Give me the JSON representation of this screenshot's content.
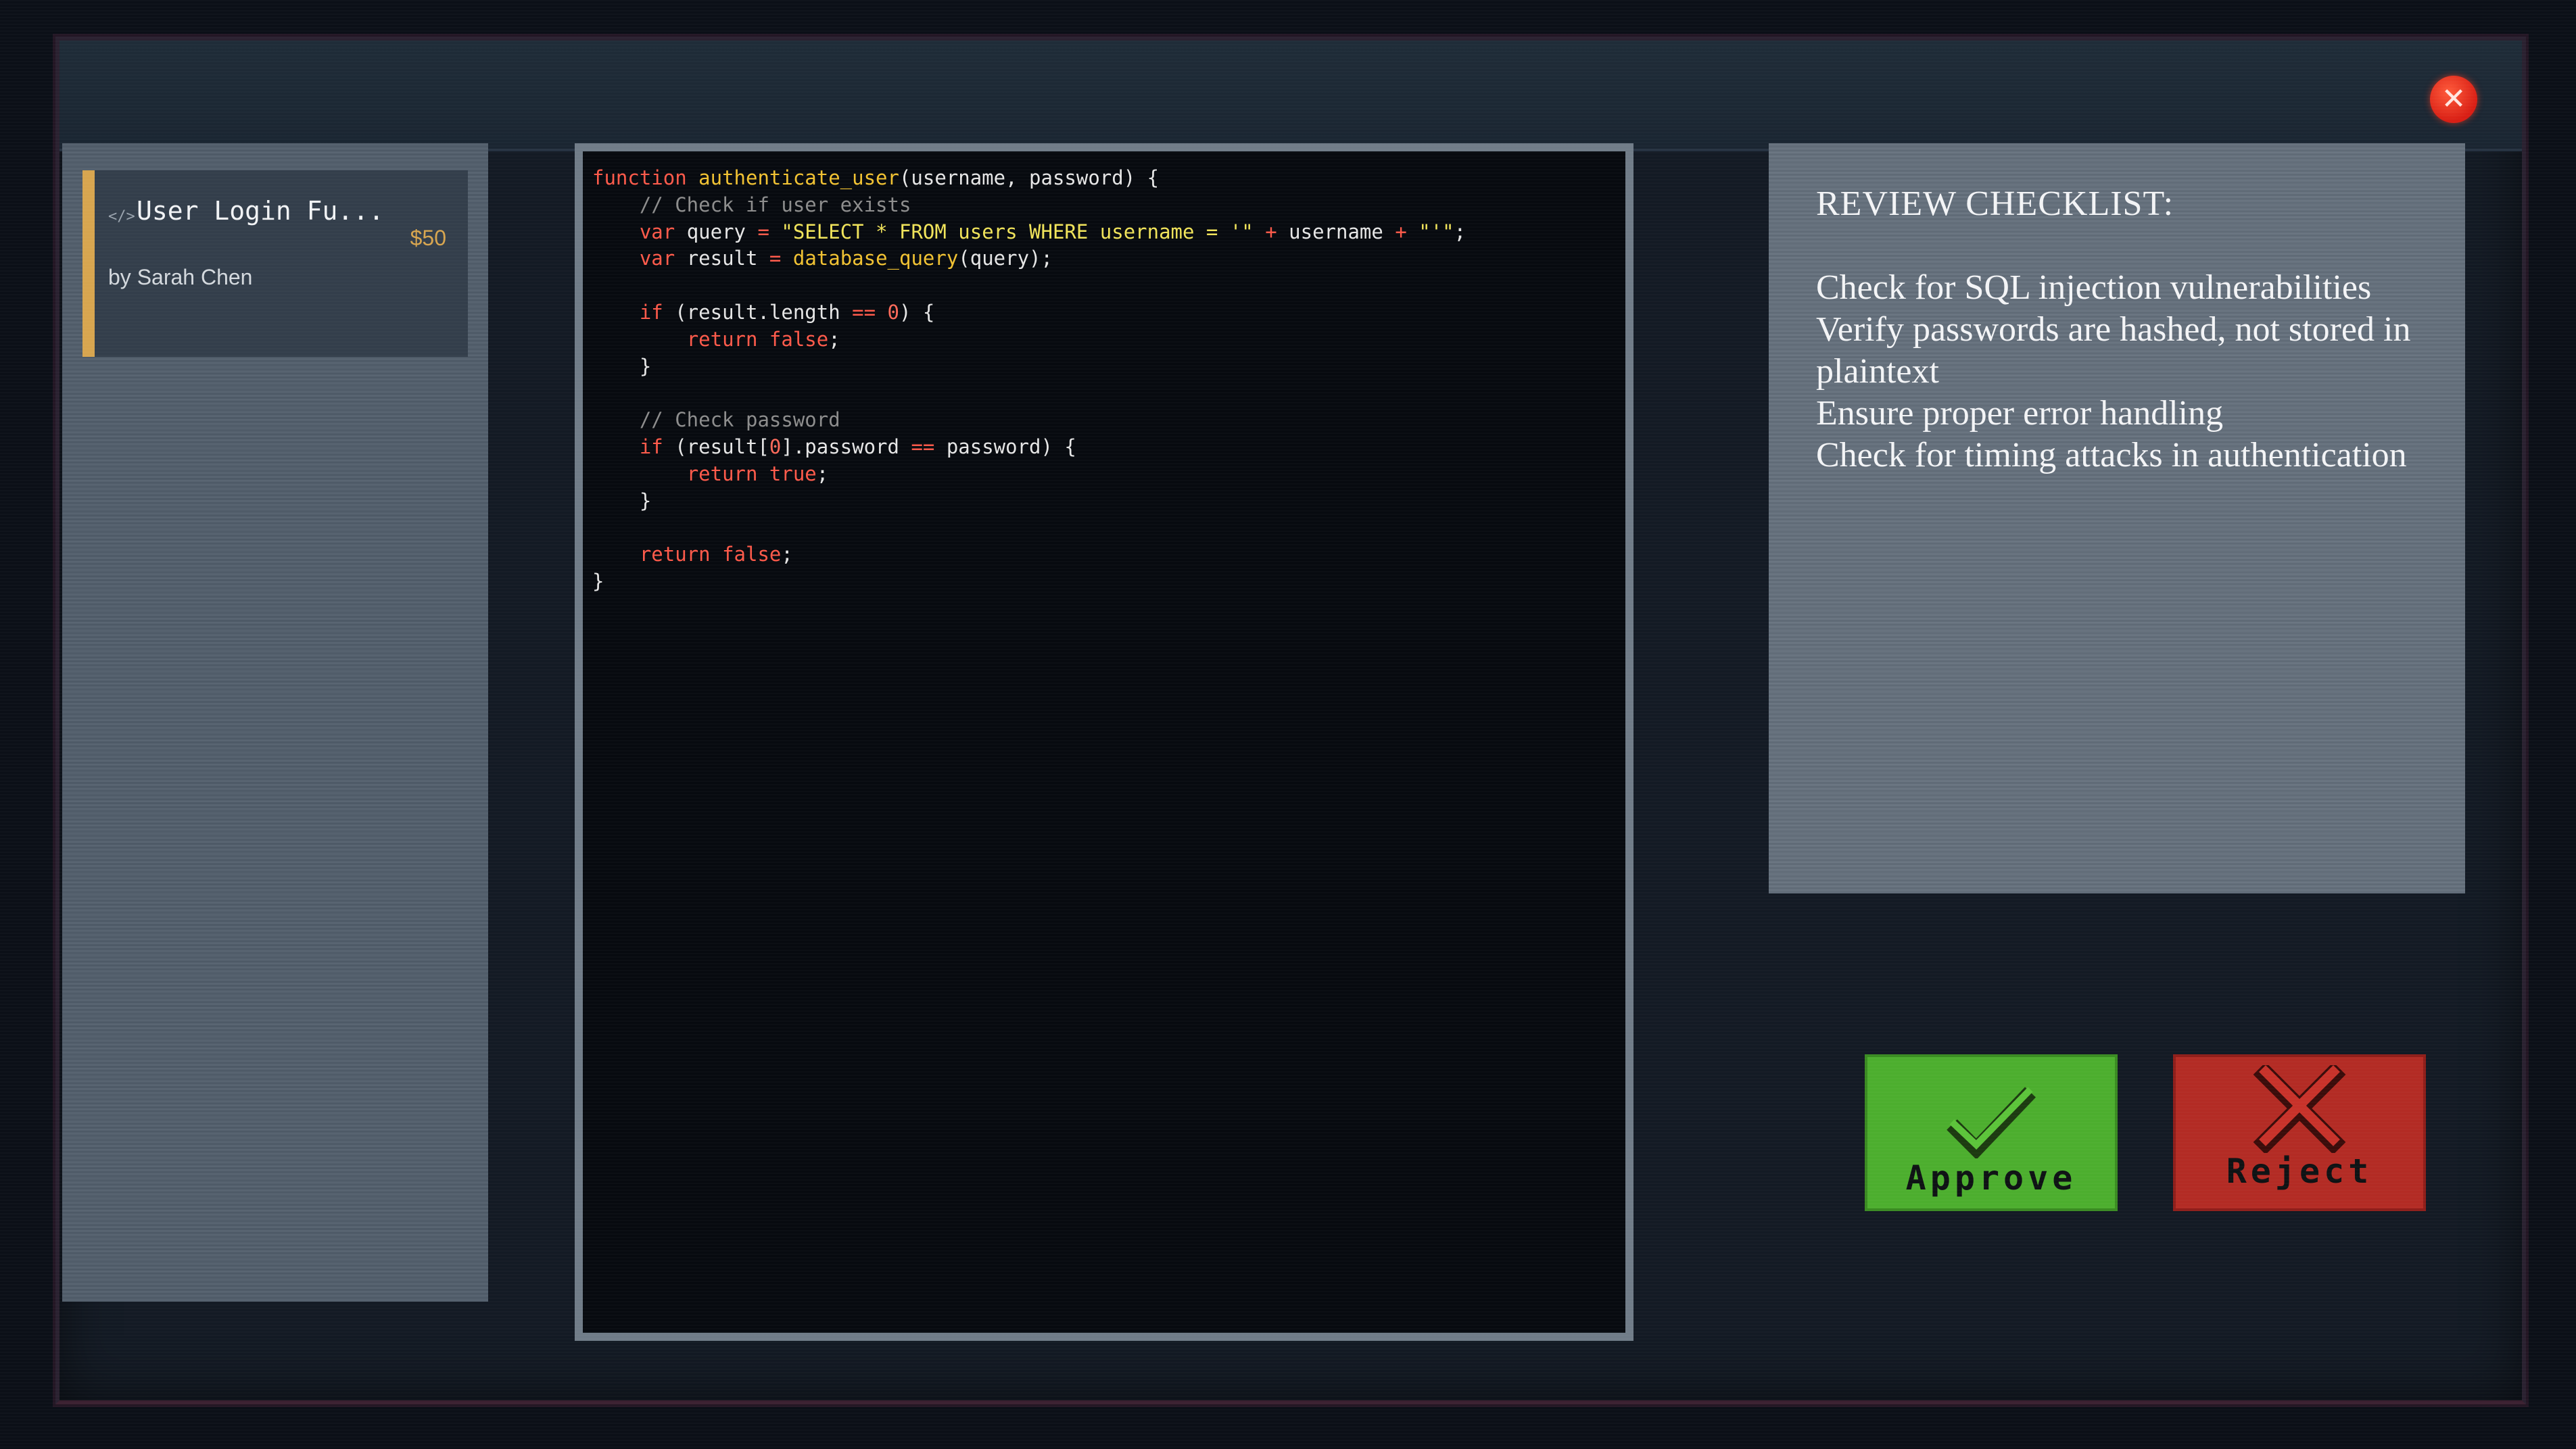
{
  "window": {
    "close_icon": "close-icon",
    "close_glyph": "✕"
  },
  "task_list": {
    "items": [
      {
        "icon": "code-icon",
        "icon_glyph": "</>",
        "title": "User Login Fu...",
        "reward": "$50",
        "author": "by Sarah Chen",
        "accent_color": "#d7a54f"
      }
    ]
  },
  "code_viewer": {
    "language_colors": {
      "keyword": "#ff5a4a",
      "function": "#f1c232",
      "string": "#f0e35a",
      "comment": "#8d8d8d"
    },
    "lines": [
      [
        {
          "t": "kw",
          "v": "function"
        },
        {
          "t": "",
          "v": " "
        },
        {
          "t": "fn",
          "v": "authenticate_user"
        },
        {
          "t": "",
          "v": "(username, password) {"
        }
      ],
      [
        {
          "t": "",
          "v": "    "
        },
        {
          "t": "cm",
          "v": "// Check if user exists"
        }
      ],
      [
        {
          "t": "",
          "v": "    "
        },
        {
          "t": "kw",
          "v": "var"
        },
        {
          "t": "",
          "v": " query "
        },
        {
          "t": "op",
          "v": "="
        },
        {
          "t": "",
          "v": " "
        },
        {
          "t": "str",
          "v": "\"SELECT * FROM users WHERE username = '\""
        },
        {
          "t": "",
          "v": " "
        },
        {
          "t": "op",
          "v": "+"
        },
        {
          "t": "",
          "v": " username "
        },
        {
          "t": "op",
          "v": "+"
        },
        {
          "t": "",
          "v": " "
        },
        {
          "t": "str",
          "v": "\"'\""
        },
        {
          "t": "",
          "v": ";"
        }
      ],
      [
        {
          "t": "",
          "v": "    "
        },
        {
          "t": "kw",
          "v": "var"
        },
        {
          "t": "",
          "v": " result "
        },
        {
          "t": "op",
          "v": "="
        },
        {
          "t": "",
          "v": " "
        },
        {
          "t": "fn",
          "v": "database_query"
        },
        {
          "t": "",
          "v": "(query);"
        }
      ],
      [],
      [
        {
          "t": "",
          "v": "    "
        },
        {
          "t": "kw",
          "v": "if"
        },
        {
          "t": "",
          "v": " (result.length "
        },
        {
          "t": "op",
          "v": "=="
        },
        {
          "t": "",
          "v": " "
        },
        {
          "t": "num",
          "v": "0"
        },
        {
          "t": "",
          "v": ") {"
        }
      ],
      [
        {
          "t": "",
          "v": "        "
        },
        {
          "t": "kw",
          "v": "return"
        },
        {
          "t": "",
          "v": " "
        },
        {
          "t": "kw",
          "v": "false"
        },
        {
          "t": "",
          "v": ";"
        }
      ],
      [
        {
          "t": "",
          "v": "    }"
        }
      ],
      [],
      [
        {
          "t": "",
          "v": "    "
        },
        {
          "t": "cm",
          "v": "// Check password"
        }
      ],
      [
        {
          "t": "",
          "v": "    "
        },
        {
          "t": "kw",
          "v": "if"
        },
        {
          "t": "",
          "v": " (result["
        },
        {
          "t": "num",
          "v": "0"
        },
        {
          "t": "",
          "v": "].password "
        },
        {
          "t": "op",
          "v": "=="
        },
        {
          "t": "",
          "v": " password) {"
        }
      ],
      [
        {
          "t": "",
          "v": "        "
        },
        {
          "t": "kw",
          "v": "return"
        },
        {
          "t": "",
          "v": " "
        },
        {
          "t": "kw",
          "v": "true"
        },
        {
          "t": "",
          "v": ";"
        }
      ],
      [
        {
          "t": "",
          "v": "    }"
        }
      ],
      [],
      [
        {
          "t": "",
          "v": "    "
        },
        {
          "t": "kw",
          "v": "return"
        },
        {
          "t": "",
          "v": " "
        },
        {
          "t": "kw",
          "v": "false"
        },
        {
          "t": "",
          "v": ";"
        }
      ],
      [
        {
          "t": "",
          "v": "}"
        }
      ]
    ]
  },
  "checklist": {
    "title": "REVIEW CHECKLIST:",
    "items": [
      "Check for SQL injection vulnerabilities",
      "Verify passwords are hashed, not stored in plaintext",
      "Ensure proper error handling",
      "Check for timing attacks in authentication"
    ]
  },
  "actions": {
    "approve_label": "Approve",
    "approve_icon": "checkmark-icon",
    "approve_color": "#4cae2e",
    "reject_label": "Reject",
    "reject_icon": "x-mark-icon",
    "reject_color": "#b32b24"
  }
}
